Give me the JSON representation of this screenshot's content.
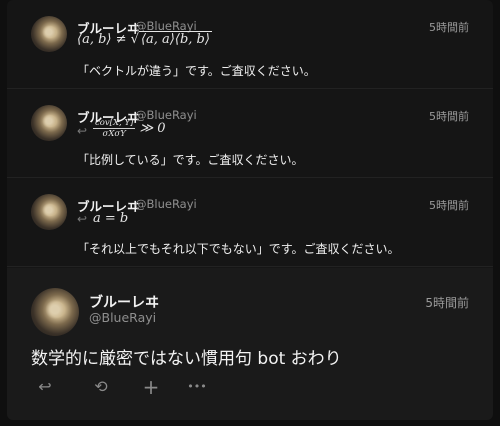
{
  "replies": [
    {
      "author": "ブルーレヰ",
      "handle": "@BlueRayi",
      "time": "5時間前",
      "math": {
        "a": "a",
        "b": "b",
        "neq": "≠",
        "sqrt": "√",
        "lhs": "⟨a, b⟩",
        "rhs": "⟨a, a⟩⟨b, b⟩"
      },
      "body": "「ベクトルが違う」です。ご査収ください。"
    },
    {
      "author": "ブルーレヰ",
      "handle": "@BlueRayi",
      "time": "5時間前",
      "reply_icon": "reply-icon",
      "math": {
        "num": "cov[X, Y]",
        "den": "σXσY",
        "rel": "≫ 0"
      },
      "body": "「比例している」です。ご査収ください。"
    },
    {
      "author": "ブルーレヰ",
      "handle": "@BlueRayi",
      "time": "5時間前",
      "reply_icon": "reply-icon",
      "math": {
        "expr": "a = b"
      },
      "body": "「それ以上でもそれ以下でもない」です。ご査収ください。"
    }
  ],
  "main": {
    "author": "ブルーレヰ",
    "handle": "@BlueRayi",
    "time": "5時間前",
    "body": "数学的に厳密ではない慣用句 bot おわり",
    "actions": [
      {
        "name": "reply-icon",
        "glyph": "↩"
      },
      {
        "name": "retweet-icon",
        "glyph": "⟲"
      },
      {
        "name": "add-icon",
        "glyph": "+"
      },
      {
        "name": "more-icon",
        "glyph": "•••"
      }
    ]
  }
}
